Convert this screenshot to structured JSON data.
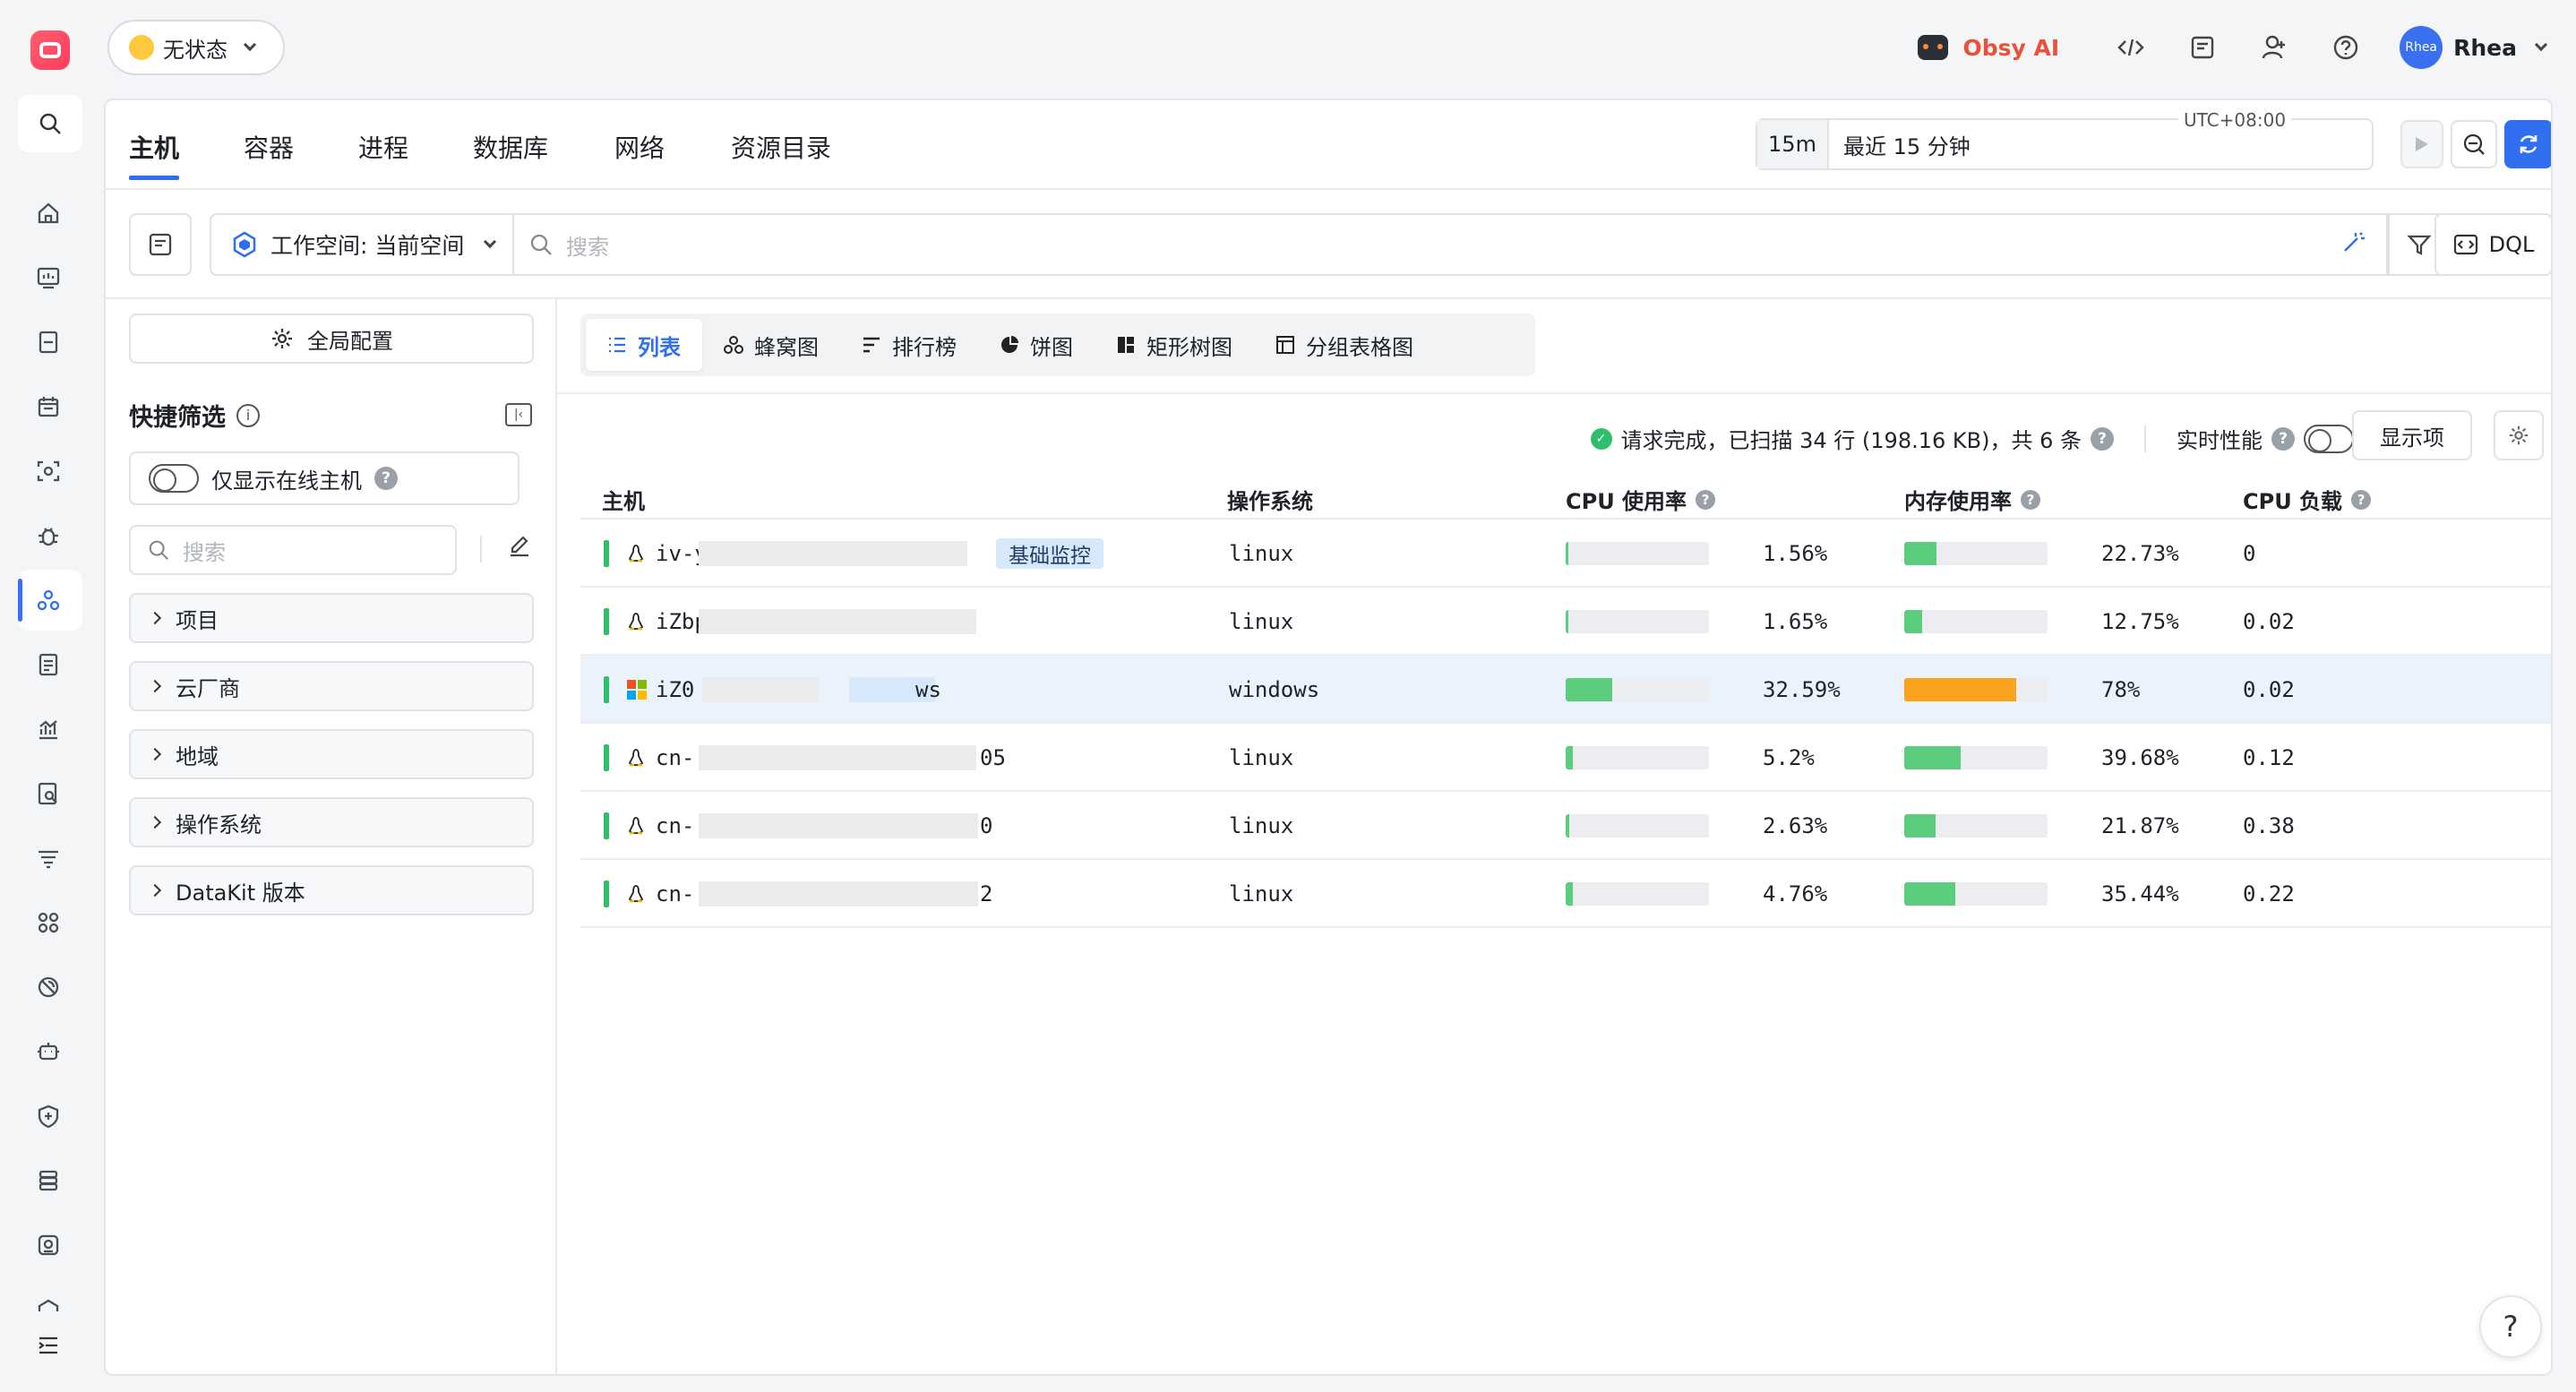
{
  "topbar": {
    "status_label": "无状态",
    "obsy_label": "Obsy AI",
    "user_avatar_text": "Rhea",
    "user_name": "Rhea",
    "icons": [
      "code-icon",
      "report-icon",
      "user-add-icon",
      "help-icon"
    ]
  },
  "main_tabs": [
    "主机",
    "容器",
    "进程",
    "数据库",
    "网络",
    "资源目录"
  ],
  "time": {
    "short": "15m",
    "range": "最近 15 分钟",
    "timezone": "UTC+08:00"
  },
  "filterbar": {
    "workspace_label": "工作空间: 当前空间",
    "search_placeholder": "搜索",
    "dql_label": "DQL"
  },
  "side_panel": {
    "global_config_label": "全局配置",
    "quick_filter_title": "快捷筛选",
    "online_only_label": "仅显示在线主机",
    "search_placeholder": "搜索",
    "groups": [
      "项目",
      "云厂商",
      "地域",
      "操作系统",
      "DataKit 版本"
    ]
  },
  "view_tabs": [
    "列表",
    "蜂窝图",
    "排行榜",
    "饼图",
    "矩形树图",
    "分组表格图"
  ],
  "status_text": "请求完成，已扫描 34 行 (198.16 KB)，共 6 条",
  "realtime_label": "实时性能",
  "display_items_label": "显示项",
  "table": {
    "headers": {
      "host": "主机",
      "os": "操作系统",
      "cpu": "CPU 使用率",
      "mem": "内存使用率",
      "load": "CPU 负载"
    },
    "rows": [
      {
        "host_prefix": "iv-y",
        "host_suffix": "",
        "tag": "基础监控",
        "os": "linux",
        "cpu": 1.56,
        "cpu_text": "1.56%",
        "mem": 22.73,
        "mem_text": "22.73%",
        "load": "0",
        "selected": false
      },
      {
        "host_prefix": "iZbp",
        "host_suffix": "",
        "tag": "",
        "os": "linux",
        "cpu": 1.65,
        "cpu_text": "1.65%",
        "mem": 12.75,
        "mem_text": "12.75%",
        "load": "0.02",
        "selected": false
      },
      {
        "host_prefix": "iZ0",
        "host_suffix": "ws",
        "tag": "",
        "os": "windows",
        "cpu": 32.59,
        "cpu_text": "32.59%",
        "mem": 78,
        "mem_text": "78%",
        "load": "0.02",
        "selected": true
      },
      {
        "host_prefix": "cn-",
        "host_suffix": "05",
        "tag": "",
        "os": "linux",
        "cpu": 5.2,
        "cpu_text": "5.2%",
        "mem": 39.68,
        "mem_text": "39.68%",
        "load": "0.12",
        "selected": false
      },
      {
        "host_prefix": "cn-",
        "host_suffix": "0",
        "tag": "",
        "os": "linux",
        "cpu": 2.63,
        "cpu_text": "2.63%",
        "mem": 21.87,
        "mem_text": "21.87%",
        "load": "0.38",
        "selected": false
      },
      {
        "host_prefix": "cn-",
        "host_suffix": "2",
        "tag": "",
        "os": "linux",
        "cpu": 4.76,
        "cpu_text": "4.76%",
        "mem": 35.44,
        "mem_text": "35.44%",
        "load": "0.22",
        "selected": false
      }
    ]
  },
  "colors": {
    "accent": "#2f6ff0",
    "bar_normal": "#5ccc7d",
    "bar_warning": "#f9a21c",
    "online": "#2fbf6b"
  }
}
